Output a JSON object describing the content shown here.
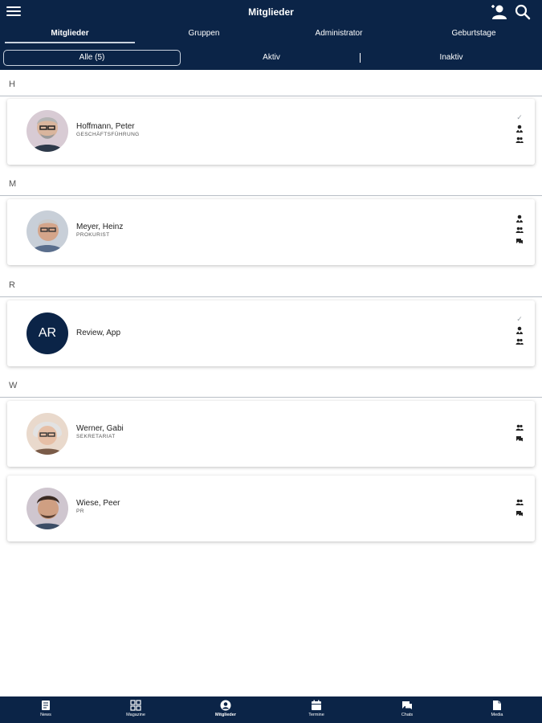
{
  "header": {
    "title": "Mitglieder"
  },
  "tabs": [
    {
      "label": "Mitglieder"
    },
    {
      "label": "Gruppen"
    },
    {
      "label": "Administrator"
    },
    {
      "label": "Geburtstage"
    }
  ],
  "filters": [
    {
      "label": "Alle (5)"
    },
    {
      "label": "Aktiv"
    },
    {
      "label": "Inaktiv"
    }
  ],
  "sections": [
    {
      "letter": "H"
    },
    {
      "letter": "M"
    },
    {
      "letter": "R"
    },
    {
      "letter": "W"
    }
  ],
  "members": [
    {
      "name": "Hoffmann, Peter",
      "role": "GESCHÄFTSFÜHRUNG",
      "icons": [
        "check-icon",
        "admin-icon",
        "group-icon"
      ]
    },
    {
      "name": "Meyer, Heinz",
      "role": "PROKURIST",
      "icons": [
        "admin-icon",
        "group-icon",
        "chat-icon"
      ]
    },
    {
      "name": "Review, App",
      "role": "",
      "initials": "AR",
      "icons": [
        "check-icon",
        "admin-icon",
        "group-icon"
      ]
    },
    {
      "name": "Werner, Gabi",
      "role": "SEKRETARIAT",
      "icons": [
        "group-icon",
        "chat-icon"
      ]
    },
    {
      "name": "Wiese, Peer",
      "role": "PR",
      "icons": [
        "group-icon",
        "chat-icon"
      ]
    }
  ],
  "bottom_nav": [
    {
      "label": "News",
      "icon": "news-icon"
    },
    {
      "label": "Magazine",
      "icon": "grid-icon"
    },
    {
      "label": "Mitglieder",
      "icon": "person-icon"
    },
    {
      "label": "Termine",
      "icon": "calendar-icon"
    },
    {
      "label": "Chats",
      "icon": "chat-icon"
    },
    {
      "label": "Media",
      "icon": "file-icon"
    }
  ],
  "colors": {
    "primary": "#0b2447",
    "background": "#ffffff"
  }
}
